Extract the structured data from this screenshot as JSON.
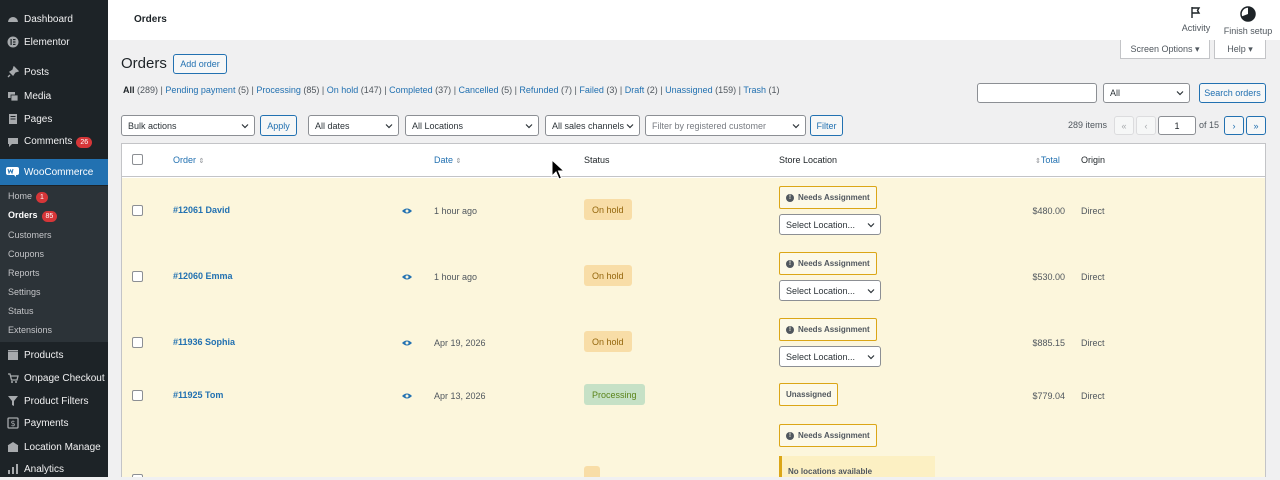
{
  "sidebar": {
    "items": [
      {
        "label": "Dashboard",
        "icon": "dashboard-icon"
      },
      {
        "label": "Elementor",
        "icon": "elementor-icon"
      },
      {
        "label": "Posts",
        "icon": "pin-icon"
      },
      {
        "label": "Media",
        "icon": "media-icon"
      },
      {
        "label": "Pages",
        "icon": "page-icon"
      },
      {
        "label": "Comments",
        "icon": "comment-icon",
        "badge": "26"
      },
      {
        "label": "WooCommerce",
        "icon": "woo-icon"
      },
      {
        "label": "Products",
        "icon": "products-icon"
      },
      {
        "label": "Onpage Checkout",
        "icon": "cart-icon"
      },
      {
        "label": "Product Filters",
        "icon": "filter-icon"
      },
      {
        "label": "Payments",
        "icon": "payments-icon"
      },
      {
        "label": "Location Manage",
        "icon": "location-icon"
      },
      {
        "label": "Analytics",
        "icon": "analytics-icon"
      }
    ],
    "submenu": [
      {
        "label": "Home",
        "badge": "1"
      },
      {
        "label": "Orders",
        "badge": "85"
      },
      {
        "label": "Customers"
      },
      {
        "label": "Coupons"
      },
      {
        "label": "Reports"
      },
      {
        "label": "Settings"
      },
      {
        "label": "Status"
      },
      {
        "label": "Extensions"
      }
    ]
  },
  "topbar": {
    "title": "Orders",
    "activity": "Activity",
    "finish_setup": "Finish setup"
  },
  "screen_options": "Screen Options ▾",
  "help": "Help ▾",
  "page": {
    "title": "Orders",
    "add_order": "Add order"
  },
  "status_filters": [
    {
      "label": "All",
      "count": "(289)"
    },
    {
      "label": "Pending payment",
      "count": "(5)"
    },
    {
      "label": "Processing",
      "count": "(85)"
    },
    {
      "label": "On hold",
      "count": "(147)"
    },
    {
      "label": "Completed",
      "count": "(37)"
    },
    {
      "label": "Cancelled",
      "count": "(5)"
    },
    {
      "label": "Refunded",
      "count": "(7)"
    },
    {
      "label": "Failed",
      "count": "(3)"
    },
    {
      "label": "Draft",
      "count": "(2)"
    },
    {
      "label": "Unassigned",
      "count": "(159)"
    },
    {
      "label": "Trash",
      "count": "(1)"
    }
  ],
  "search": {
    "scope": "All",
    "button": "Search orders"
  },
  "toolbar": {
    "bulk_actions": "Bulk actions",
    "apply": "Apply",
    "dates": "All dates",
    "locations": "All Locations",
    "channels": "All sales channels",
    "customer_placeholder": "Filter by registered customer",
    "filter": "Filter",
    "items": "289 items",
    "first": "«",
    "prev": "‹",
    "page": "1",
    "of_pages": "of 15",
    "next": "›",
    "last": "»"
  },
  "table": {
    "headers": {
      "order": "Order",
      "date": "Date",
      "status": "Status",
      "store_location": "Store Location",
      "total": "Total",
      "origin": "Origin"
    },
    "rows": [
      {
        "order": "#12061 David",
        "date": "1 hour ago",
        "status": "On hold",
        "location_state": "Needs Assignment",
        "select": "Select Location...",
        "total": "$480.00",
        "origin": "Direct"
      },
      {
        "order": "#12060 Emma",
        "date": "1 hour ago",
        "status": "On hold",
        "location_state": "Needs Assignment",
        "select": "Select Location...",
        "total": "$530.00",
        "origin": "Direct"
      },
      {
        "order": "#11936 Sophia",
        "date": "Apr 19, 2026",
        "status": "On hold",
        "location_state": "Needs Assignment",
        "select": "Select Location...",
        "total": "$885.15",
        "origin": "Direct"
      },
      {
        "order": "#11925 Tom",
        "date": "Apr 13, 2026",
        "status": "Processing",
        "location_state": "Unassigned",
        "total": "$779.04",
        "origin": "Direct"
      },
      {
        "location_state": "Needs Assignment",
        "no_locations": "No locations available"
      }
    ]
  },
  "colors": {
    "sidebar_bg": "#1d2327",
    "accent": "#2271b1",
    "row_highlight": "#fcf6dc",
    "on_hold_bg": "#f8dda7",
    "processing_bg": "#c6e1c6",
    "badge": "#d63638"
  }
}
